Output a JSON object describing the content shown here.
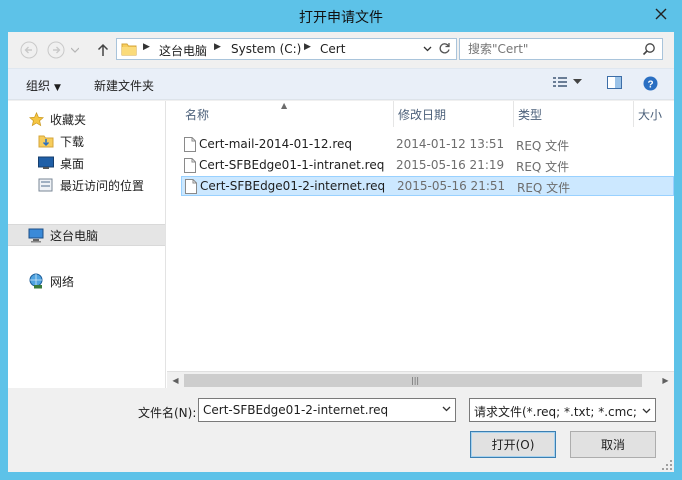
{
  "window": {
    "title": "打开申请文件"
  },
  "toolbar": {
    "breadcrumb": [
      "这台电脑",
      "System (C:)",
      "Cert"
    ],
    "search_placeholder": "搜索\"Cert\""
  },
  "commands": {
    "organize": "组织",
    "new_folder": "新建文件夹"
  },
  "nav": {
    "items": [
      {
        "label": "收藏夹",
        "icon": "star-icon"
      },
      {
        "label": "下载",
        "icon": "download-folder-icon"
      },
      {
        "label": "桌面",
        "icon": "desktop-icon"
      },
      {
        "label": "最近访问的位置",
        "icon": "recent-places-icon"
      },
      {
        "label": "这台电脑",
        "icon": "computer-icon"
      },
      {
        "label": "网络",
        "icon": "network-icon"
      }
    ]
  },
  "columns": [
    "名称",
    "修改日期",
    "类型",
    "大小"
  ],
  "files": [
    {
      "name": "Cert-mail-2014-01-12.req",
      "date": "2014-01-12 13:51",
      "type": "REQ 文件"
    },
    {
      "name": "Cert-SFBEdge01-1-intranet.req",
      "date": "2015-05-16 21:19",
      "type": "REQ 文件"
    },
    {
      "name": "Cert-SFBEdge01-2-internet.req",
      "date": "2015-05-16 21:51",
      "type": "REQ 文件"
    }
  ],
  "selected_file_index": 2,
  "selected_nav_index": 4,
  "bottom": {
    "filename_label": "文件名(N):",
    "filename_value": "Cert-SFBEdge01-2-internet.req",
    "filetype_value": "请求文件(*.req; *.txt; *.cmc; *.c",
    "open_label": "打开(O)",
    "cancel_label": "取消"
  },
  "colors": {
    "titlebar": "#5dc2e8",
    "selection": "#cce8ff",
    "command_bar": "#e9eff8"
  }
}
